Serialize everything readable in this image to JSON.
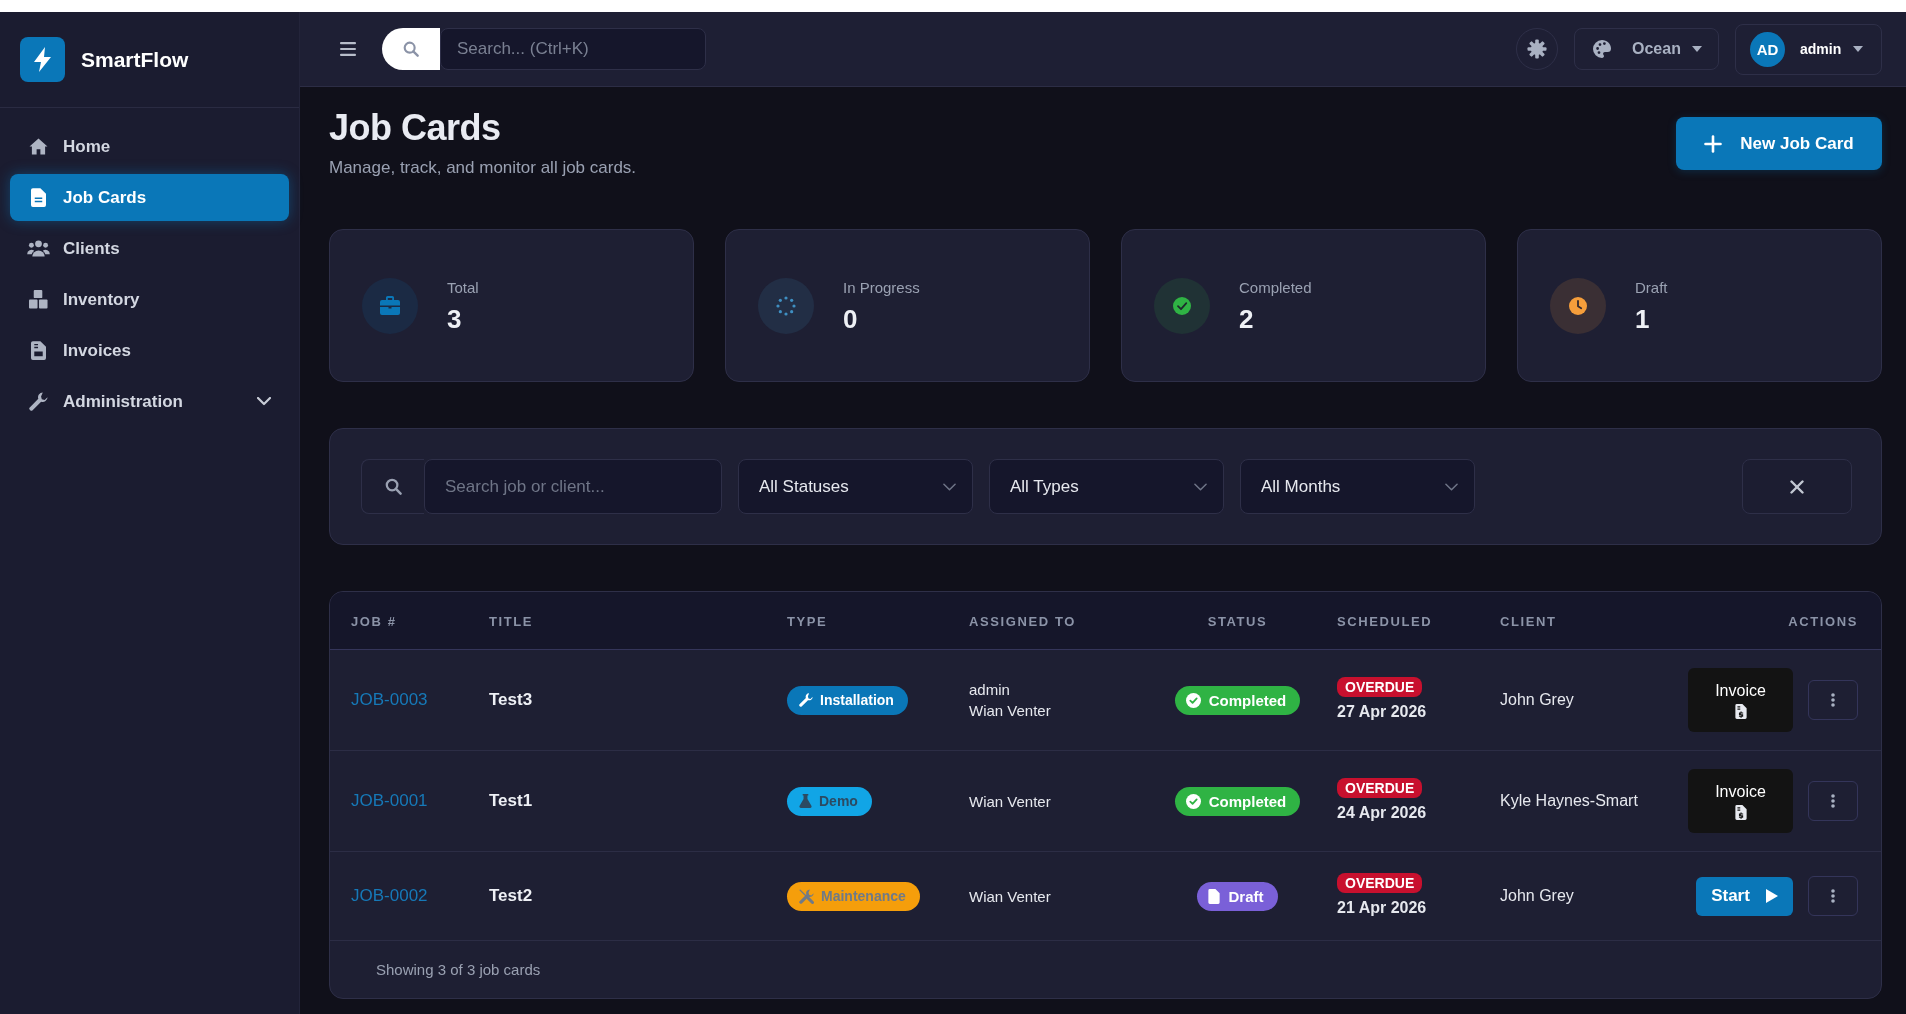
{
  "sidebar": {
    "brand": "SmartFlow",
    "items": [
      {
        "label": "Home",
        "selected": false
      },
      {
        "label": "Job Cards",
        "selected": true
      },
      {
        "label": "Clients",
        "selected": false
      },
      {
        "label": "Inventory",
        "selected": false
      },
      {
        "label": "Invoices",
        "selected": false
      },
      {
        "label": "Administration",
        "selected": false,
        "expanded": false
      }
    ]
  },
  "topbar": {
    "search": {
      "placeholder": "Search... (Ctrl+K)"
    },
    "theme": {
      "value": "Ocean"
    },
    "user": {
      "initials": "AD",
      "name": "admin"
    }
  },
  "page": {
    "title": "Job Cards",
    "subtitle": "Manage, track, and monitor all job cards.",
    "new_button": "New Job Card"
  },
  "stats": [
    {
      "label": "Total",
      "value": "3",
      "color": "#0a77b8"
    },
    {
      "label": "In Progress",
      "value": "0",
      "color": "#3f8fc2"
    },
    {
      "label": "Completed",
      "value": "2",
      "color": "#2fb344"
    },
    {
      "label": "Draft",
      "value": "1",
      "color": "#f59e3b"
    }
  ],
  "filters": {
    "search": {
      "placeholder": "Search job or client..."
    },
    "selects": [
      {
        "value": "All Statuses"
      },
      {
        "value": "All Types"
      },
      {
        "value": "All Months"
      }
    ]
  },
  "table": {
    "columns": [
      "JOB #",
      "TITLE",
      "TYPE",
      "ASSIGNED TO",
      "STATUS",
      "SCHEDULED",
      "CLIENT",
      "ACTIONS"
    ],
    "rows": [
      {
        "job": "JOB-0003",
        "title": "Test3",
        "type": {
          "label": "Installation",
          "kind": "installation",
          "color": "#0a77b8"
        },
        "assigned": [
          "admin",
          "Wian Venter"
        ],
        "status": {
          "label": "Completed",
          "kind": "completed",
          "color": "#2fb344"
        },
        "flag": "OVERDUE",
        "scheduled": "27 Apr 2026",
        "client": "John Grey",
        "action": {
          "kind": "invoice",
          "label": "Invoice"
        }
      },
      {
        "job": "JOB-0001",
        "title": "Test1",
        "type": {
          "label": "Demo",
          "kind": "demo",
          "color": "#11a5e6"
        },
        "assigned": [
          "Wian Venter"
        ],
        "status": {
          "label": "Completed",
          "kind": "completed",
          "color": "#2fb344"
        },
        "flag": "OVERDUE",
        "scheduled": "24 Apr 2026",
        "client": "Kyle Haynes-Smart",
        "action": {
          "kind": "invoice",
          "label": "Invoice"
        }
      },
      {
        "job": "JOB-0002",
        "title": "Test2",
        "type": {
          "label": "Maintenance",
          "kind": "maintenance",
          "color": "#f59e0b"
        },
        "assigned": [
          "Wian Venter"
        ],
        "status": {
          "label": "Draft",
          "kind": "draft",
          "color": "#7a60d8"
        },
        "flag": "OVERDUE",
        "scheduled": "21 Apr 2026",
        "client": "John Grey",
        "action": {
          "kind": "start",
          "label": "Start"
        }
      }
    ],
    "footer": "Showing 3 of 3 job cards"
  }
}
